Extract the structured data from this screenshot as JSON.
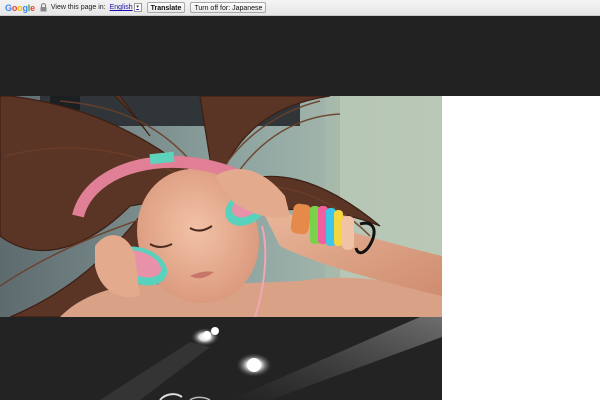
{
  "translate_bar": {
    "logo": [
      "G",
      "o",
      "o",
      "g",
      "l",
      "e"
    ],
    "lock_icon": "lock-icon",
    "prompt": "View this page in:",
    "language": "English",
    "translate_label": "Translate",
    "turn_off_label": "Turn off for: Japanese",
    "colors": {
      "logo_blue": "#4285f4",
      "logo_red": "#ea4335",
      "logo_yellow": "#fbbc05",
      "logo_green": "#34a853"
    }
  },
  "header": {
    "background": "#222222"
  },
  "images": [
    {
      "name": "girl-with-headphones-photo"
    },
    {
      "name": "stage-lights-photo"
    }
  ]
}
